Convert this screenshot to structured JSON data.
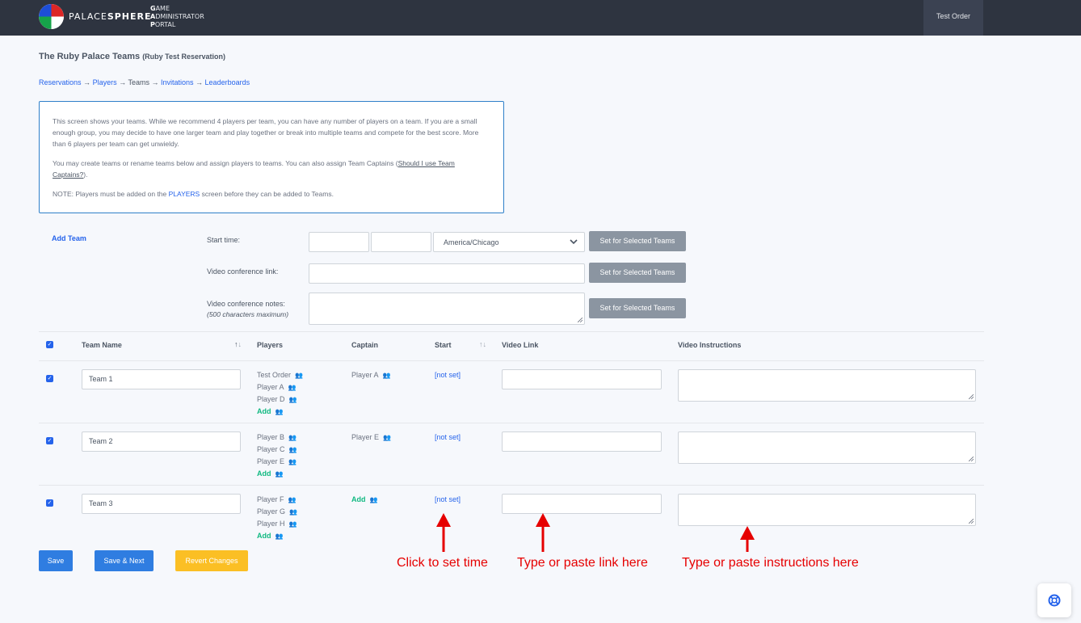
{
  "header": {
    "brand_light": "PALACE",
    "brand_bold": "SPHERE",
    "portal_lines": [
      {
        "initial": "G",
        "rest": "AME"
      },
      {
        "initial": "A",
        "rest": "DMINISTRATOR"
      },
      {
        "initial": "P",
        "rest": "ORTAL"
      }
    ],
    "user_button": "Test Order"
  },
  "page": {
    "title": "The Ruby Palace Teams",
    "subtitle": "(Ruby Test Reservation)"
  },
  "breadcrumb": {
    "reservations": "Reservations",
    "players": "Players",
    "teams": "Teams",
    "invitations": "Invitations",
    "leaderboards": "Leaderboards",
    "separator": "→"
  },
  "info": {
    "p1": "This screen shows your teams. While we recommend 4 players per team, you can have any number of players on a team. If you are a small enough group, you may decide to have one larger team and play together or break into multiple teams and compete for the best score. More than 6 players per team can get unwieldy.",
    "p2_before": "You may create teams or rename teams below and assign players to teams. You can also assign Team Captains (",
    "p2_link": "Should I use Team Captains?",
    "p2_after": ").",
    "p3_before": "NOTE: Players must be added on the ",
    "p3_link": "PLAYERS",
    "p3_after": " screen before they can be added to Teams."
  },
  "controls": {
    "add_team": "Add Team",
    "start_time_label": "Start time:",
    "timezone": "America/Chicago",
    "video_link_label": "Video conference link:",
    "video_notes_label": "Video conference notes:",
    "video_notes_hint": "(500 characters maximum)",
    "set_button": "Set for Selected Teams"
  },
  "table": {
    "headers": {
      "team_name": "Team Name",
      "players": "Players",
      "captain": "Captain",
      "start": "Start",
      "video_link": "Video Link",
      "video_instructions": "Video Instructions"
    },
    "add_label": "Add",
    "rows": [
      {
        "name": "Team 1",
        "players": [
          "Test Order",
          "Player A",
          "Player D"
        ],
        "captain": "Player A",
        "start": "[not set]"
      },
      {
        "name": "Team 2",
        "players": [
          "Player B",
          "Player C",
          "Player E"
        ],
        "captain": "Player E",
        "start": "[not set]"
      },
      {
        "name": "Team 3",
        "players": [
          "Player F",
          "Player G",
          "Player H"
        ],
        "captain": "",
        "start": "[not set]"
      }
    ]
  },
  "actions": {
    "save": "Save",
    "save_next": "Save & Next",
    "revert": "Revert Changes"
  },
  "annotations": {
    "time": "Click to set time",
    "link": "Type or paste link here",
    "instructions": "Type or paste instructions here"
  },
  "colors": {
    "topbar": "#2e3440",
    "primary": "#2563eb",
    "warning": "#fbbf24",
    "annotation": "#e60000",
    "success": "#10b981"
  }
}
